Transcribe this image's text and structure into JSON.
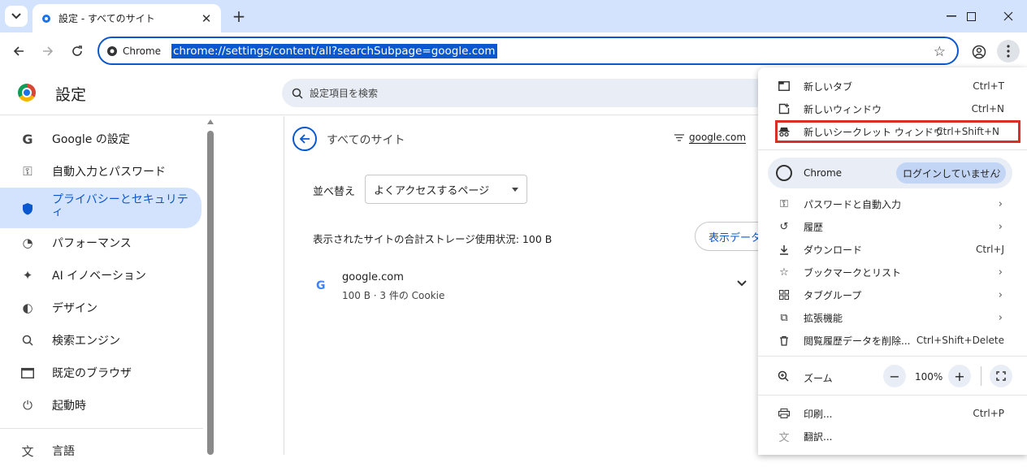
{
  "tab": {
    "title": "設定 - すべてのサイト"
  },
  "omnibox": {
    "chip": "Chrome",
    "url": "chrome://settings/content/all?searchSubpage=google.com"
  },
  "settings": {
    "title": "設定",
    "search_placeholder": "設定項目を検索"
  },
  "sidebar": {
    "items": [
      {
        "label": "Google の設定",
        "icon": "google-g-icon"
      },
      {
        "label": "自動入力とパスワード",
        "icon": "key-icon"
      },
      {
        "label": "プライバシーとセキュリティ",
        "icon": "shield-icon"
      },
      {
        "label": "パフォーマンス",
        "icon": "speedometer-icon"
      },
      {
        "label": "AI イノベーション",
        "icon": "sparkle-icon"
      },
      {
        "label": "デザイン",
        "icon": "palette-icon"
      },
      {
        "label": "検索エンジン",
        "icon": "search-icon"
      },
      {
        "label": "既定のブラウザ",
        "icon": "browser-window-icon"
      },
      {
        "label": "起動時",
        "icon": "power-icon"
      },
      {
        "label": "言語",
        "icon": "translate-icon"
      }
    ]
  },
  "content": {
    "title": "すべてのサイト",
    "filter_value": "google.com",
    "sort_label": "並べ替え",
    "sort_value": "よくアクセスするページ",
    "storage_text": "表示されたサイトの合計ストレージ使用状況: 100 B",
    "clear_button": "表示データ",
    "site": {
      "name": "google.com",
      "detail": "100 B · 3 件の Cookie"
    }
  },
  "menu": {
    "items_top": [
      {
        "label": "新しいタブ",
        "shortcut": "Ctrl+T",
        "icon": "new-tab-icon"
      },
      {
        "label": "新しいウィンドウ",
        "shortcut": "Ctrl+N",
        "icon": "new-window-icon"
      },
      {
        "label": "新しいシークレット ウィンドウ",
        "shortcut": "Ctrl+Shift+N",
        "icon": "incognito-icon"
      }
    ],
    "profile": {
      "name": "Chrome",
      "status": "ログインしていません"
    },
    "items_mid": [
      {
        "label": "パスワードと自動入力",
        "icon": "key-icon",
        "chevron": "›"
      },
      {
        "label": "履歴",
        "icon": "history-icon",
        "chevron": "›"
      },
      {
        "label": "ダウンロード",
        "icon": "download-icon",
        "shortcut": "Ctrl+J"
      },
      {
        "label": "ブックマークとリスト",
        "icon": "star-icon",
        "chevron": "›"
      },
      {
        "label": "タブグループ",
        "icon": "tab-groups-icon",
        "chevron": "›"
      },
      {
        "label": "拡張機能",
        "icon": "extension-icon",
        "chevron": "›"
      },
      {
        "label": "閲覧履歴データを削除...",
        "icon": "trash-icon",
        "shortcut": "Ctrl+Shift+Delete"
      }
    ],
    "zoom": {
      "label": "ズーム",
      "value": "100%"
    },
    "items_bottom": [
      {
        "label": "印刷...",
        "icon": "print-icon",
        "shortcut": "Ctrl+P"
      },
      {
        "label": "翻訳...",
        "icon": "translate-icon"
      }
    ]
  },
  "colors": {
    "accent": "#0b57d0",
    "tabstrip": "#d3e3fd",
    "highlight_border": "#d93025"
  }
}
